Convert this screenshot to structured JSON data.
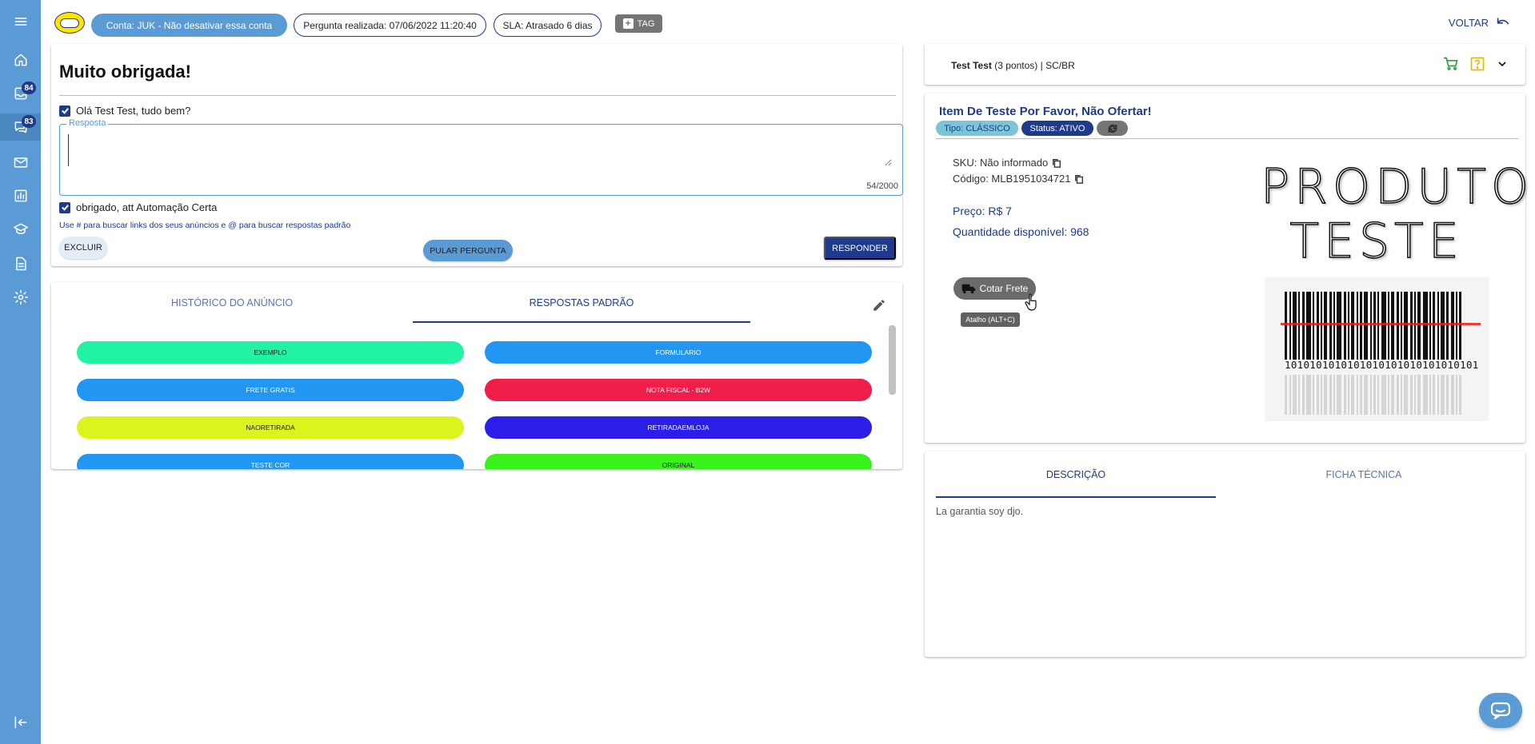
{
  "header": {
    "account_chip": "Conta: JUK - Não desativar essa conta",
    "question_date_chip": "Pergunta realizada: 07/06/2022 11:20:40",
    "sla_chip": "SLA: Atrasado 6 dias",
    "tag_button": "TAG",
    "back_button": "VOLTAR"
  },
  "sidebar": {
    "inbox_badge": "84",
    "questions_badge": "83"
  },
  "question": {
    "title": "Muito obrigada!",
    "greeting_checkbox": "Olá Test Test, tudo bem?",
    "response_label": "Resposta",
    "response_value": "",
    "char_count": "54/2000",
    "signature_checkbox": "obrigado, att Automação Certa",
    "hint": "Use # para buscar links dos seus anúncios e @ para buscar respostas padrão",
    "delete_button": "EXCLUIR",
    "skip_button": "PULAR PERGUNTA",
    "reply_button": "RESPONDER"
  },
  "tabs": {
    "history": "HISTÓRICO DO ANÚNCIO",
    "standard": "RESPOSTAS PADRÃO"
  },
  "standard_responses": [
    {
      "label": "EXEMPLO",
      "color": "#22f2a4",
      "text_color": "#1a1a1a"
    },
    {
      "label": "FORMULARIO",
      "color": "#2196f3",
      "text_color": "#ffffff"
    },
    {
      "label": "FRETE GRATIS",
      "color": "#2196f3",
      "text_color": "#ffffff"
    },
    {
      "label": "NOTA FISCAL - B2W",
      "color": "#f01e4b",
      "text_color": "#ffffff"
    },
    {
      "label": "NAORETIRADA",
      "color": "#dcf41e",
      "text_color": "#1a1a1a"
    },
    {
      "label": "RETIRADAEMLOJA",
      "color": "#2b1ee6",
      "text_color": "#ffffff"
    },
    {
      "label": "TESTE COR",
      "color": "#2196f3",
      "text_color": "#ffffff"
    },
    {
      "label": "ORIGINAL",
      "color": "#3cf21e",
      "text_color": "#1a1a1a"
    }
  ],
  "customer": {
    "name": "Test Test",
    "points": "(3 pontos) | SC/BR"
  },
  "product": {
    "title": "Item De Teste Por Favor, Não Ofertar!",
    "type_chip": "Tipo: CLÁSSICO",
    "status_chip": "Status: ATIVO",
    "sku": "SKU: Não informado",
    "code": "Código: MLB1951034721",
    "price": "Preço: R$ 7",
    "quantity": "Quantidade disponível: 968",
    "freight_button": "Cotar Frete",
    "freight_tooltip": "Atalho (ALT+C)",
    "image_text_line1": "PRODUTO",
    "image_text_line2": "TESTE",
    "barcode_digits": "1010101010101010101010101010101"
  },
  "details_tabs": {
    "description": "DESCRIÇÃO",
    "technical": "FICHA TÉCNICA",
    "description_text": "La garantia soy djo."
  },
  "colors": {
    "sidebar": "#5b9bd5",
    "primary": "#1e3a8a",
    "secondary": "#5b9bd5"
  }
}
